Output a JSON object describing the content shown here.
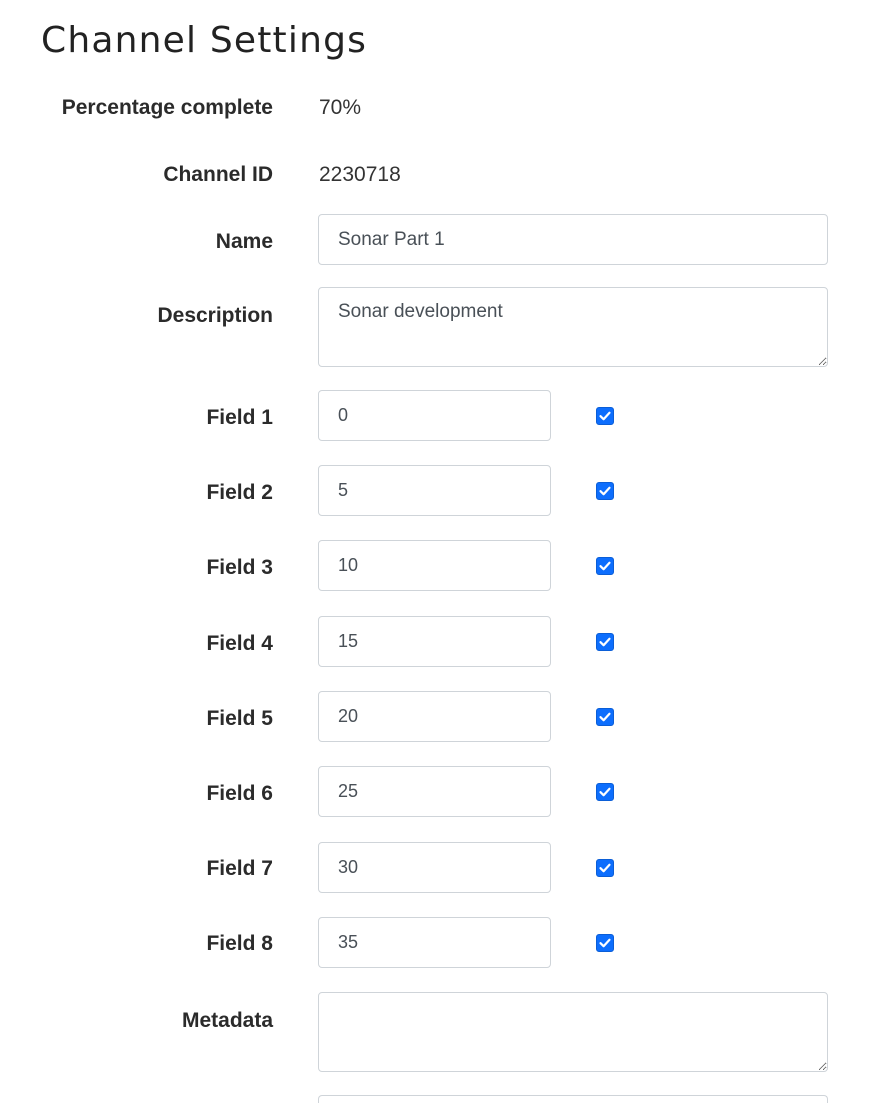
{
  "page": {
    "title": "Channel Settings"
  },
  "form": {
    "percentage": {
      "label": "Percentage complete",
      "value": "70%"
    },
    "channel_id": {
      "label": "Channel ID",
      "value": "2230718"
    },
    "name": {
      "label": "Name",
      "value": "Sonar Part 1"
    },
    "description": {
      "label": "Description",
      "value": "Sonar development"
    },
    "fields": [
      {
        "label": "Field 1",
        "value": "0",
        "checked": true
      },
      {
        "label": "Field 2",
        "value": "5",
        "checked": true
      },
      {
        "label": "Field 3",
        "value": "10",
        "checked": true
      },
      {
        "label": "Field 4",
        "value": "15",
        "checked": true
      },
      {
        "label": "Field 5",
        "value": "20",
        "checked": true
      },
      {
        "label": "Field 6",
        "value": "25",
        "checked": true
      },
      {
        "label": "Field 7",
        "value": "30",
        "checked": true
      },
      {
        "label": "Field 8",
        "value": "35",
        "checked": true
      }
    ],
    "metadata": {
      "label": "Metadata",
      "value": ""
    }
  },
  "colors": {
    "checkbox_accent": "#0d6efd",
    "input_border": "#cfd4d9"
  }
}
